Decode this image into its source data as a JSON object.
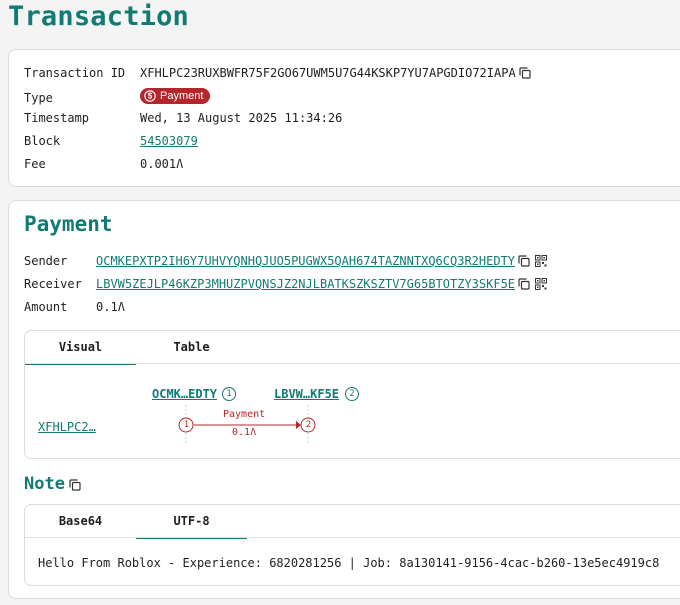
{
  "page": {
    "title": "Transaction"
  },
  "transaction": {
    "id_label": "Transaction ID",
    "id_value": "XFHLPC23RUXBWFR75F2GO67UWM5U7G44KSKP7YU7APGDIO72IAPA",
    "type_label": "Type",
    "type_value": "Payment",
    "timestamp_label": "Timestamp",
    "timestamp_value": "Wed, 13 August 2025 11:34:26",
    "block_label": "Block",
    "block_value": "54503079",
    "fee_label": "Fee",
    "fee_value": "0.001",
    "algo_symbol": "Ʌ"
  },
  "payment": {
    "title": "Payment",
    "sender_label": "Sender",
    "sender_value": "OCMKEPXTP2IH6Y7UHVYQNHQJUO5PUGWX5QAH674TAZNNTXQ6CQ3R2HEDTY",
    "receiver_label": "Receiver",
    "receiver_value": "LBVW5ZEJLP46KZP3MHUZPVQNSJZ2NJLBATKSZKSZTV7G65BTOTZY3SKF5E",
    "amount_label": "Amount",
    "amount_value": "0.1"
  },
  "visual_tabs": {
    "visual": "Visual",
    "table": "Table"
  },
  "visual": {
    "txn_link": "XFHLPC2…",
    "account1": "OCMK…EDTY",
    "account1_num": "1",
    "account2": "LBVW…KF5E",
    "account2_num": "2",
    "arrow_label": "Payment",
    "arrow_amount": "0.1"
  },
  "note": {
    "title": "Note",
    "tab_base64": "Base64",
    "tab_utf8": "UTF-8",
    "text": "Hello From Roblox - Experience: 6820281256 | Job: 8a130141-9156-4cac-b260-13e5ec4919c8"
  },
  "colors": {
    "accent": "#127a73",
    "badge": "#b3262c",
    "diagram": "#b3262c"
  }
}
